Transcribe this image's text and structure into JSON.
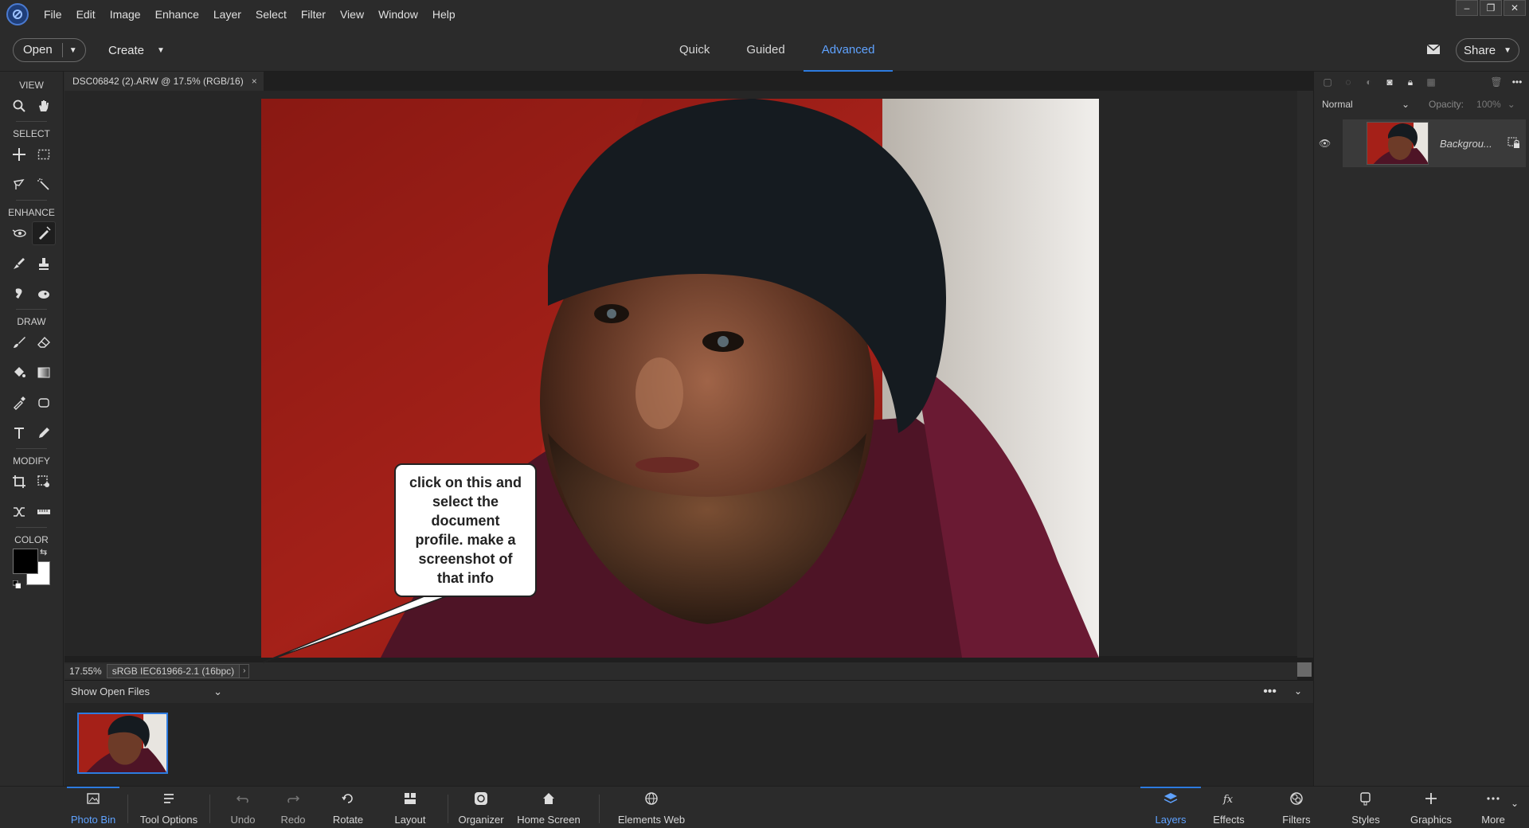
{
  "menu": [
    "File",
    "Edit",
    "Image",
    "Enhance",
    "Layer",
    "Select",
    "Filter",
    "View",
    "Window",
    "Help"
  ],
  "header": {
    "open_label": "Open",
    "create_label": "Create",
    "modes": [
      "Quick",
      "Guided",
      "Advanced"
    ],
    "active_mode": "Advanced",
    "share_label": "Share"
  },
  "toolbox": {
    "sections": {
      "view": "VIEW",
      "select": "SELECT",
      "enhance": "ENHANCE",
      "draw": "DRAW",
      "modify": "MODIFY",
      "color": "COLOR"
    },
    "foreground_color": "#000000",
    "background_color": "#ffffff"
  },
  "document": {
    "tab_title": "DSC06842 (2).ARW @ 17.5% (RGB/16)",
    "zoom": "17.55%",
    "profile": "sRGB IEC61966-2.1 (16bpc)"
  },
  "callout": {
    "text": "click on this and select the document profile.   make a screenshot of that info"
  },
  "photo_bin": {
    "dropdown": "Show Open Files"
  },
  "layers_panel": {
    "blend_mode": "Normal",
    "opacity_label": "Opacity:",
    "opacity_value": "100%",
    "layer_name": "Backgrou..."
  },
  "bottom_bar": {
    "photo_bin": "Photo Bin",
    "tool_options": "Tool Options",
    "undo": "Undo",
    "redo": "Redo",
    "rotate": "Rotate",
    "layout": "Layout",
    "organizer": "Organizer",
    "home_screen": "Home Screen",
    "elements_web": "Elements Web",
    "layers": "Layers",
    "effects": "Effects",
    "filters": "Filters",
    "styles": "Styles",
    "graphics": "Graphics",
    "more": "More"
  },
  "accent_color": "#2d7be0"
}
